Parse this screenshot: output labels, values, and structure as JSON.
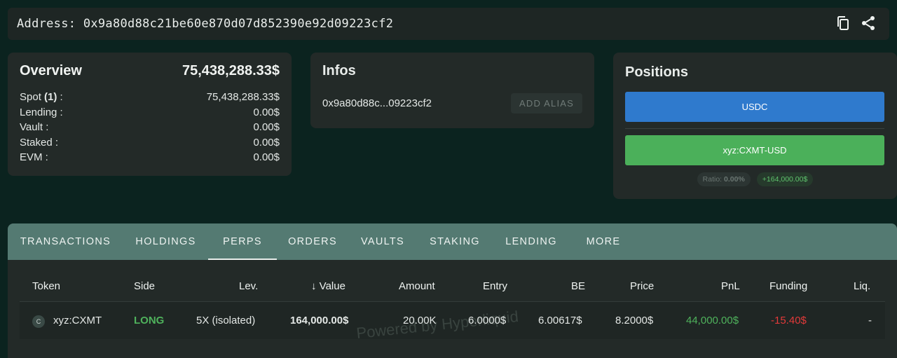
{
  "address_bar": {
    "label": "Address:",
    "address": "0x9a80d88c21be60e870d07d852390e92d09223cf2",
    "icons": [
      "copy-icon",
      "share-icon"
    ]
  },
  "overview": {
    "title": "Overview",
    "total": "75,438,288.33$",
    "rows": [
      {
        "label": "Spot",
        "count": "(1)",
        "suffix": " :",
        "value": "75,438,288.33$"
      },
      {
        "label": "Lending :",
        "value": "0.00$"
      },
      {
        "label": "Vault :",
        "value": "0.00$"
      },
      {
        "label": "Staked :",
        "value": "0.00$"
      },
      {
        "label": "EVM :",
        "value": "0.00$"
      }
    ]
  },
  "infos": {
    "title": "Infos",
    "short_address": "0x9a80d88c...09223cf2",
    "add_alias": "ADD ALIAS"
  },
  "positions": {
    "title": "Positions",
    "usdc": "USDC",
    "xyz": "xyz:CXMT-USD",
    "ratio_label": "Ratio:",
    "ratio_value": "0.00%",
    "pnl": "+164,000.00$"
  },
  "tabs": [
    "TRANSACTIONS",
    "HOLDINGS",
    "PERPS",
    "ORDERS",
    "VAULTS",
    "STAKING",
    "LENDING",
    "MORE"
  ],
  "active_tab": "PERPS",
  "table": {
    "headers": {
      "token": "Token",
      "side": "Side",
      "lev": "Lev.",
      "value_arrow": "↓",
      "value": "Value",
      "amount": "Amount",
      "entry": "Entry",
      "be": "BE",
      "price": "Price",
      "pnl": "PnL",
      "funding": "Funding",
      "liq": "Liq."
    },
    "row": {
      "token_icon_letter": "C",
      "token": "xyz:CXMT",
      "side": "LONG",
      "lev": "5X (isolated)",
      "value": "164,000.00$",
      "amount": "20.00K",
      "entry": "6.0000$",
      "be": "6.00617$",
      "price": "8.2000$",
      "pnl": "44,000.00$",
      "funding": "-15.40$",
      "liq": "-"
    },
    "watermark": "Powered by Hyperliquid"
  },
  "colors": {
    "background": "#0b231f",
    "card": "#232a28",
    "tabbar": "#547a72",
    "usdc_button": "#2f7acd",
    "xyz_button": "#4bb05a",
    "positive": "#4fb25c",
    "negative": "#e23a3a"
  }
}
